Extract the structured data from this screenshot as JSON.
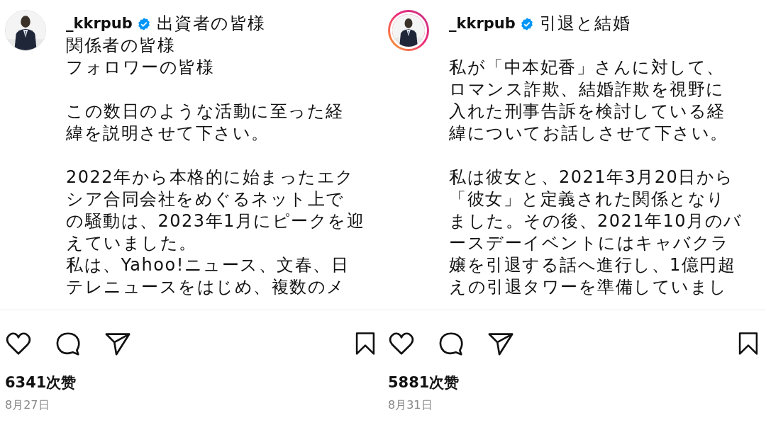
{
  "posts": [
    {
      "username": "_kkrpub",
      "verified": true,
      "story_ring": false,
      "caption": [
        [
          "出資者の皆様",
          "関係者の皆様",
          "フォロワーの皆様"
        ],
        [
          "この数日のような活動に至った経",
          "緯を説明させて下さい。"
        ],
        [
          "2022年から本格的に始まったエク",
          "シア合同会社をめぐるネット上で",
          "の騒動は、2023年1月にピークを迎",
          "えていました。",
          "私は、Yahoo!ニュース、文春、日",
          "テレニュースをはじめ、複数のメ"
        ]
      ],
      "likes": "6341次赞",
      "date": "8月27日"
    },
    {
      "username": "_kkrpub",
      "verified": true,
      "story_ring": true,
      "caption": [
        [
          "引退と結婚"
        ],
        [
          "私が「中本妃香」さんに対して、",
          "ロマンス詐欺、結婚詐欺を視野に",
          "入れた刑事告訴を検討している経",
          "緯についてお話しさせて下さい。"
        ],
        [
          "私は彼女と、2021年3月20日から",
          "「彼女」と定義された関係となり",
          "ました。その後、2021年10月のバ",
          "ースデーイベントにはキャバクラ",
          "嬢を引退する話へ進行し、1億円超",
          "えの引退タワーを準備していまし"
        ]
      ],
      "likes": "5881次赞",
      "date": "8月31日"
    }
  ]
}
